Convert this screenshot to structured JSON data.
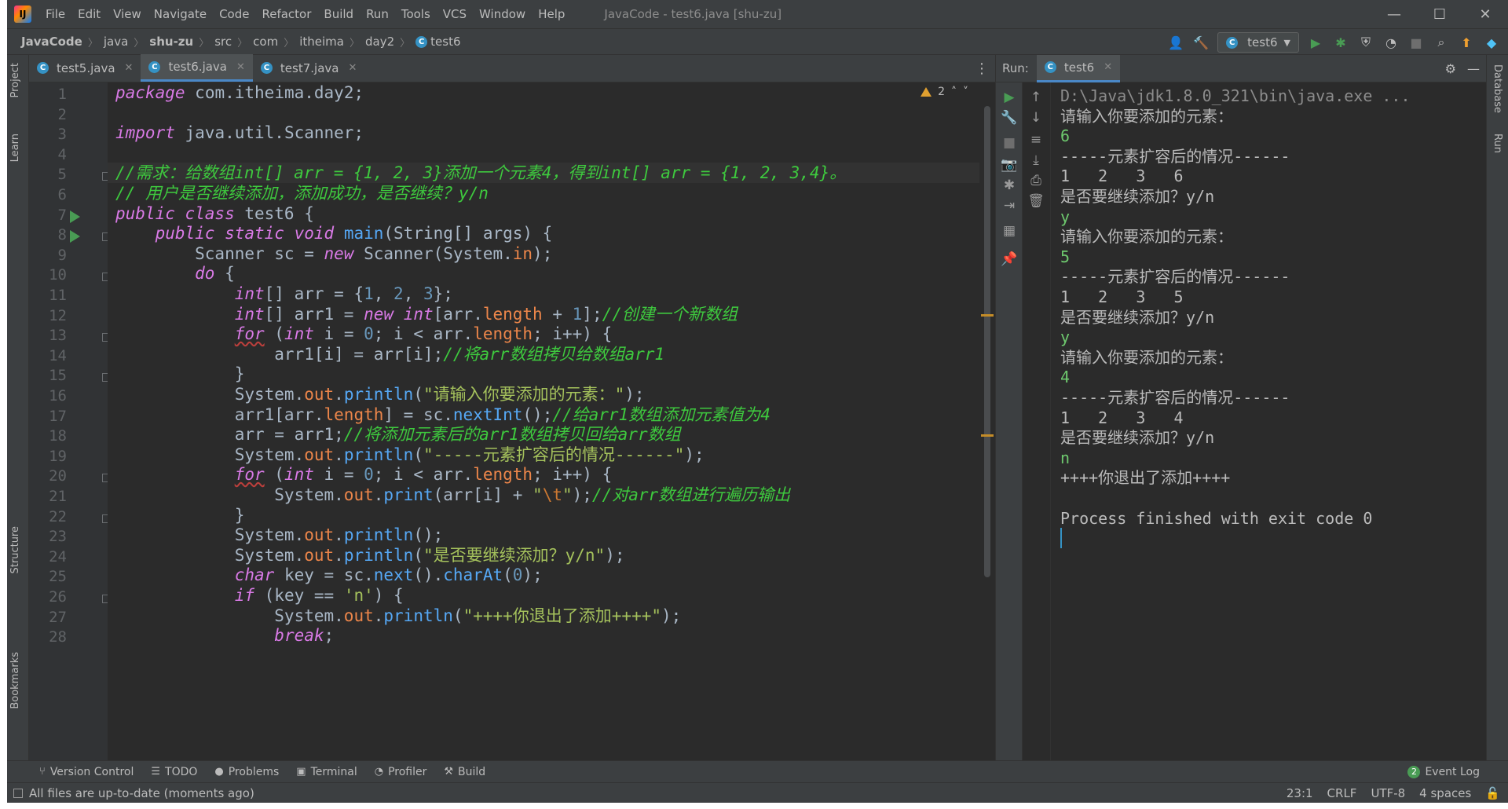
{
  "window": {
    "title": "JavaCode - test6.java [shu-zu]",
    "minimize": "—",
    "maximize": "☐",
    "close": "✕"
  },
  "menu": [
    "File",
    "Edit",
    "View",
    "Navigate",
    "Code",
    "Refactor",
    "Build",
    "Run",
    "Tools",
    "VCS",
    "Window",
    "Help"
  ],
  "breadcrumb": [
    "JavaCode",
    "java",
    "shu-zu",
    "src",
    "com",
    "itheima",
    "day2",
    "test6"
  ],
  "toolbar": {
    "run_config": "test6",
    "icons": [
      "user-icon",
      "hammer-icon",
      "run-icon",
      "debug-icon",
      "coverage-icon",
      "profile-icon",
      "stop-icon",
      "search-icon",
      "update-icon",
      "toolbox-icon"
    ]
  },
  "left_strip": {
    "project": "Project",
    "learn": "Learn",
    "structure": "Structure",
    "bookmarks": "Bookmarks"
  },
  "right_strip": {
    "database": "Database",
    "run": "Run"
  },
  "editor": {
    "tabs": [
      {
        "label": "test5.java",
        "active": false
      },
      {
        "label": "test6.java",
        "active": true
      },
      {
        "label": "test7.java",
        "active": false
      }
    ],
    "warnings": "2",
    "line_numbers": [
      "1",
      "2",
      "3",
      "4",
      "5",
      "6",
      "7",
      "8",
      "9",
      "10",
      "11",
      "12",
      "13",
      "14",
      "15",
      "16",
      "17",
      "18",
      "19",
      "20",
      "21",
      "22",
      "23",
      "24",
      "25",
      "26",
      "27",
      "28"
    ],
    "current_line": 5
  },
  "run": {
    "label": "Run:",
    "tab": "test6",
    "console": [
      {
        "text": "D:\\Java\\jdk1.8.0_321\\bin\\java.exe ...",
        "kind": "path"
      },
      {
        "text": "请输入你要添加的元素：",
        "kind": "out"
      },
      {
        "text": "6",
        "kind": "in"
      },
      {
        "text": "-----元素扩容后的情况------",
        "kind": "out"
      },
      {
        "text": "1   2   3   6",
        "kind": "out"
      },
      {
        "text": "是否要继续添加？y/n",
        "kind": "out"
      },
      {
        "text": "y",
        "kind": "in"
      },
      {
        "text": "请输入你要添加的元素：",
        "kind": "out"
      },
      {
        "text": "5",
        "kind": "in"
      },
      {
        "text": "-----元素扩容后的情况------",
        "kind": "out"
      },
      {
        "text": "1   2   3   5",
        "kind": "out"
      },
      {
        "text": "是否要继续添加？y/n",
        "kind": "out"
      },
      {
        "text": "y",
        "kind": "in"
      },
      {
        "text": "请输入你要添加的元素：",
        "kind": "out"
      },
      {
        "text": "4",
        "kind": "in"
      },
      {
        "text": "-----元素扩容后的情况------",
        "kind": "out"
      },
      {
        "text": "1   2   3   4",
        "kind": "out"
      },
      {
        "text": "是否要继续添加？y/n",
        "kind": "out"
      },
      {
        "text": "n",
        "kind": "in"
      },
      {
        "text": "++++你退出了添加++++",
        "kind": "out"
      },
      {
        "text": "",
        "kind": "out"
      },
      {
        "text": "Process finished with exit code 0",
        "kind": "out"
      }
    ]
  },
  "tool_windows": [
    "Version Control",
    "TODO",
    "Problems",
    "Terminal",
    "Profiler",
    "Build"
  ],
  "event_log": {
    "label": "Event Log",
    "count": "2"
  },
  "status": {
    "message": "All files are up-to-date (moments ago)",
    "position": "23:1",
    "line_sep": "CRLF",
    "encoding": "UTF-8",
    "indent": "4 spaces"
  }
}
